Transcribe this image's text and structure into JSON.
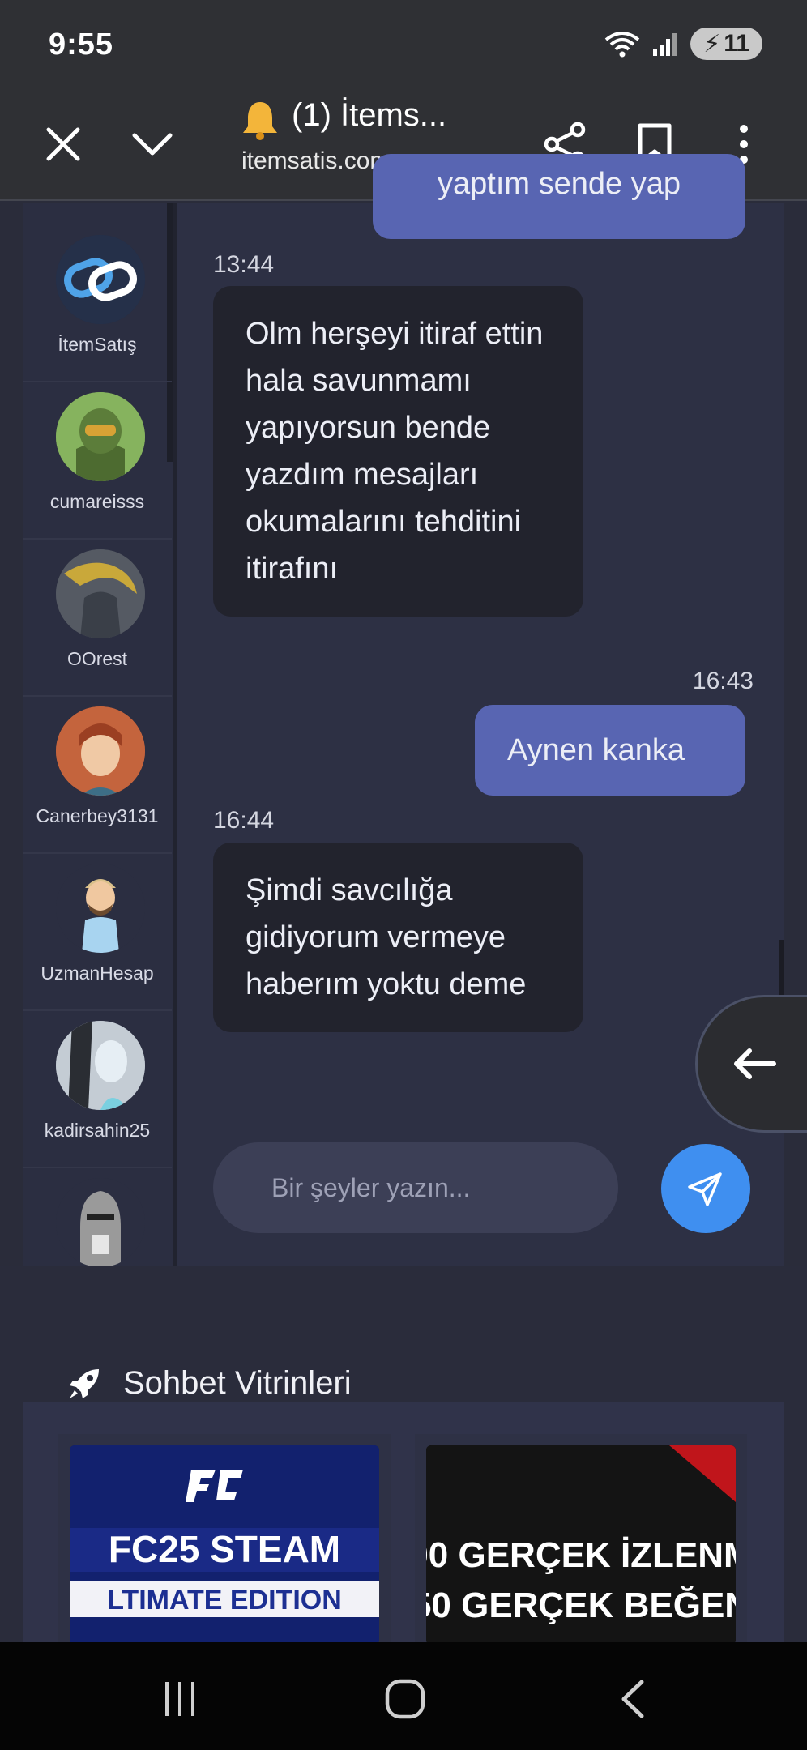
{
  "status_bar": {
    "time": "9:55",
    "battery": "11"
  },
  "browser": {
    "title": "(1) İtems...",
    "url": "itemsatis.com",
    "icons": [
      "close-icon",
      "chevron-down-icon",
      "bell-icon",
      "share-icon",
      "bookmark-icon",
      "more-vertical-icon"
    ]
  },
  "sidebar": {
    "contacts": [
      {
        "name": "İtemSatış"
      },
      {
        "name": "cumareisss"
      },
      {
        "name": "OOrest"
      },
      {
        "name": "Canerbey3131"
      },
      {
        "name": "UzmanHesap"
      },
      {
        "name": "kadirsahin25"
      },
      {
        "name": ""
      }
    ]
  },
  "chat": {
    "messages": [
      {
        "direction": "out",
        "time": "",
        "text": "yaptım sende yap"
      },
      {
        "direction": "in",
        "time": "13:44",
        "text": "Olm herşeyi itiraf ettin hala savunmamı yapıyorsun bende yazdım mesajları okumalarını tehditini itirafını"
      },
      {
        "direction": "out",
        "time": "16:43",
        "text": "Aynen kanka"
      },
      {
        "direction": "in",
        "time": "16:44",
        "text": "Şimdi savcılığa gidiyorum vermeye haberım yoktu deme"
      }
    ],
    "input_placeholder": "Bir şeyler yazın...",
    "send_icon": "send-icon",
    "back_icon": "arrow-left-icon"
  },
  "showcase": {
    "tab_label": "Sohbet Vitrinleri",
    "tab_icon": "rocket-icon",
    "cards": [
      {
        "line1": "FC25 STEAM",
        "line2": "LTIMATE EDITION"
      },
      {
        "line1": "00 GERÇEK İZLENM",
        "line2": "50 GERÇEK BEĞEN"
      }
    ]
  },
  "colors": {
    "accent": "#3f8ff0",
    "outgoing_bubble": "#5865b2",
    "incoming_bubble": "#22232d",
    "tab_underline": "#4a7ec8"
  }
}
